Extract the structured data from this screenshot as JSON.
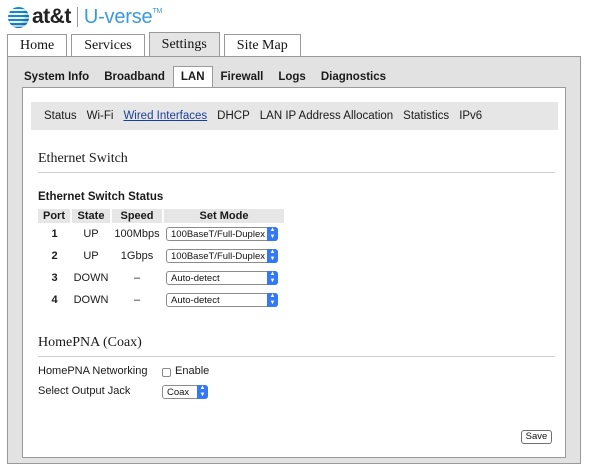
{
  "brand": {
    "company": "at&t",
    "product": "U-verse",
    "trademark": "TM"
  },
  "main_tabs": [
    "Home",
    "Services",
    "Settings",
    "Site Map"
  ],
  "main_active_tab": "Settings",
  "sub_tabs": [
    "System Info",
    "Broadband",
    "LAN",
    "Firewall",
    "Logs",
    "Diagnostics"
  ],
  "sub_active_tab": "LAN",
  "lan_nav": [
    "Status",
    "Wi-Fi",
    "Wired Interfaces",
    "DHCP",
    "LAN IP Address Allocation",
    "Statistics",
    "IPv6"
  ],
  "lan_nav_active": "Wired Interfaces",
  "ethernet_switch": {
    "title": "Ethernet Switch",
    "status_heading": "Ethernet Switch Status",
    "columns": [
      "Port",
      "State",
      "Speed",
      "Set Mode"
    ],
    "rows": [
      {
        "port": "1",
        "state": "UP",
        "speed": "100Mbps",
        "mode": "100BaseT/Full-Duplex"
      },
      {
        "port": "2",
        "state": "UP",
        "speed": "1Gbps",
        "mode": "100BaseT/Full-Duplex"
      },
      {
        "port": "3",
        "state": "DOWN",
        "speed": "–",
        "mode": "Auto-detect"
      },
      {
        "port": "4",
        "state": "DOWN",
        "speed": "–",
        "mode": "Auto-detect"
      }
    ]
  },
  "homepna": {
    "title": "HomePNA (Coax)",
    "networking_label": "HomePNA Networking",
    "enable_label": "Enable",
    "enable_checked": false,
    "output_jack_label": "Select Output Jack",
    "output_jack_value": "Coax"
  },
  "actions": {
    "save_label": "Save"
  },
  "colors": {
    "brand_blue": "#3a9bd5",
    "select_arrow": "#3478f6",
    "active_link": "#1a3f9a"
  },
  "icons": [
    "att-globe-icon",
    "select-chevron-icon",
    "checkbox-icon"
  ]
}
